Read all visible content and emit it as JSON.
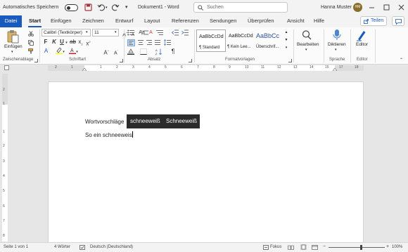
{
  "titlebar": {
    "autosave_label": "Automatisches Speichern",
    "autosave_state": "off",
    "document_title": "Dokument1 - Word",
    "search_placeholder": "Suchen",
    "user_name": "Hanna Muster",
    "user_initials": "HM"
  },
  "tabs": [
    "Datei",
    "Start",
    "Einfügen",
    "Zeichnen",
    "Entwurf",
    "Layout",
    "Referenzen",
    "Sendungen",
    "Überprüfen",
    "Ansicht",
    "Hilfe"
  ],
  "active_tab": "Start",
  "share_label": "Teilen",
  "ribbon": {
    "paste_label": "Einfügen",
    "font_name": "Calibri (Textkörper)",
    "font_size": "11",
    "styles": [
      {
        "preview": "AaBbCcDd",
        "name": "¶ Standard"
      },
      {
        "preview": "AaBbCcDd",
        "name": "¶ Kein Lee..."
      },
      {
        "preview": "AaBbCc",
        "name": "Überschrif..."
      }
    ],
    "edit_label": "Bearbeiten",
    "dictate_label": "Diktieren",
    "editor_label": "Editor",
    "groups": {
      "clipboard": "Zwischenablage",
      "font": "Schriftart",
      "paragraph": "Absatz",
      "styles": "Formatvorlagen",
      "voice": "Sprache",
      "editor": "Editor"
    }
  },
  "ruler": {
    "top_ticks": [
      "2",
      "1",
      "1",
      "2",
      "3",
      "4",
      "5",
      "6",
      "7",
      "8",
      "9",
      "10",
      "11",
      "12",
      "13",
      "14",
      "15",
      "17",
      "18"
    ],
    "left_ticks": [
      "2",
      "1",
      "1",
      "2",
      "3",
      "4",
      "5",
      "6",
      "7",
      "8"
    ]
  },
  "document": {
    "suggestions_label": "Wortvorschläge",
    "suggestions": [
      "schneeweiß",
      "Schneeweiß"
    ],
    "typed_text": "So ein schneeweis"
  },
  "statusbar": {
    "page": "Seite 1 von 1",
    "words": "4 Wörter",
    "language": "Deutsch (Deutschland)",
    "focus": "Fokus",
    "zoom": "100%",
    "zoom_level": 1.0
  },
  "colors": {
    "accent": "#185abd",
    "highlight": "#ffff00",
    "font_color": "#e81123",
    "suggestion_bg": "#2b2b2b"
  }
}
